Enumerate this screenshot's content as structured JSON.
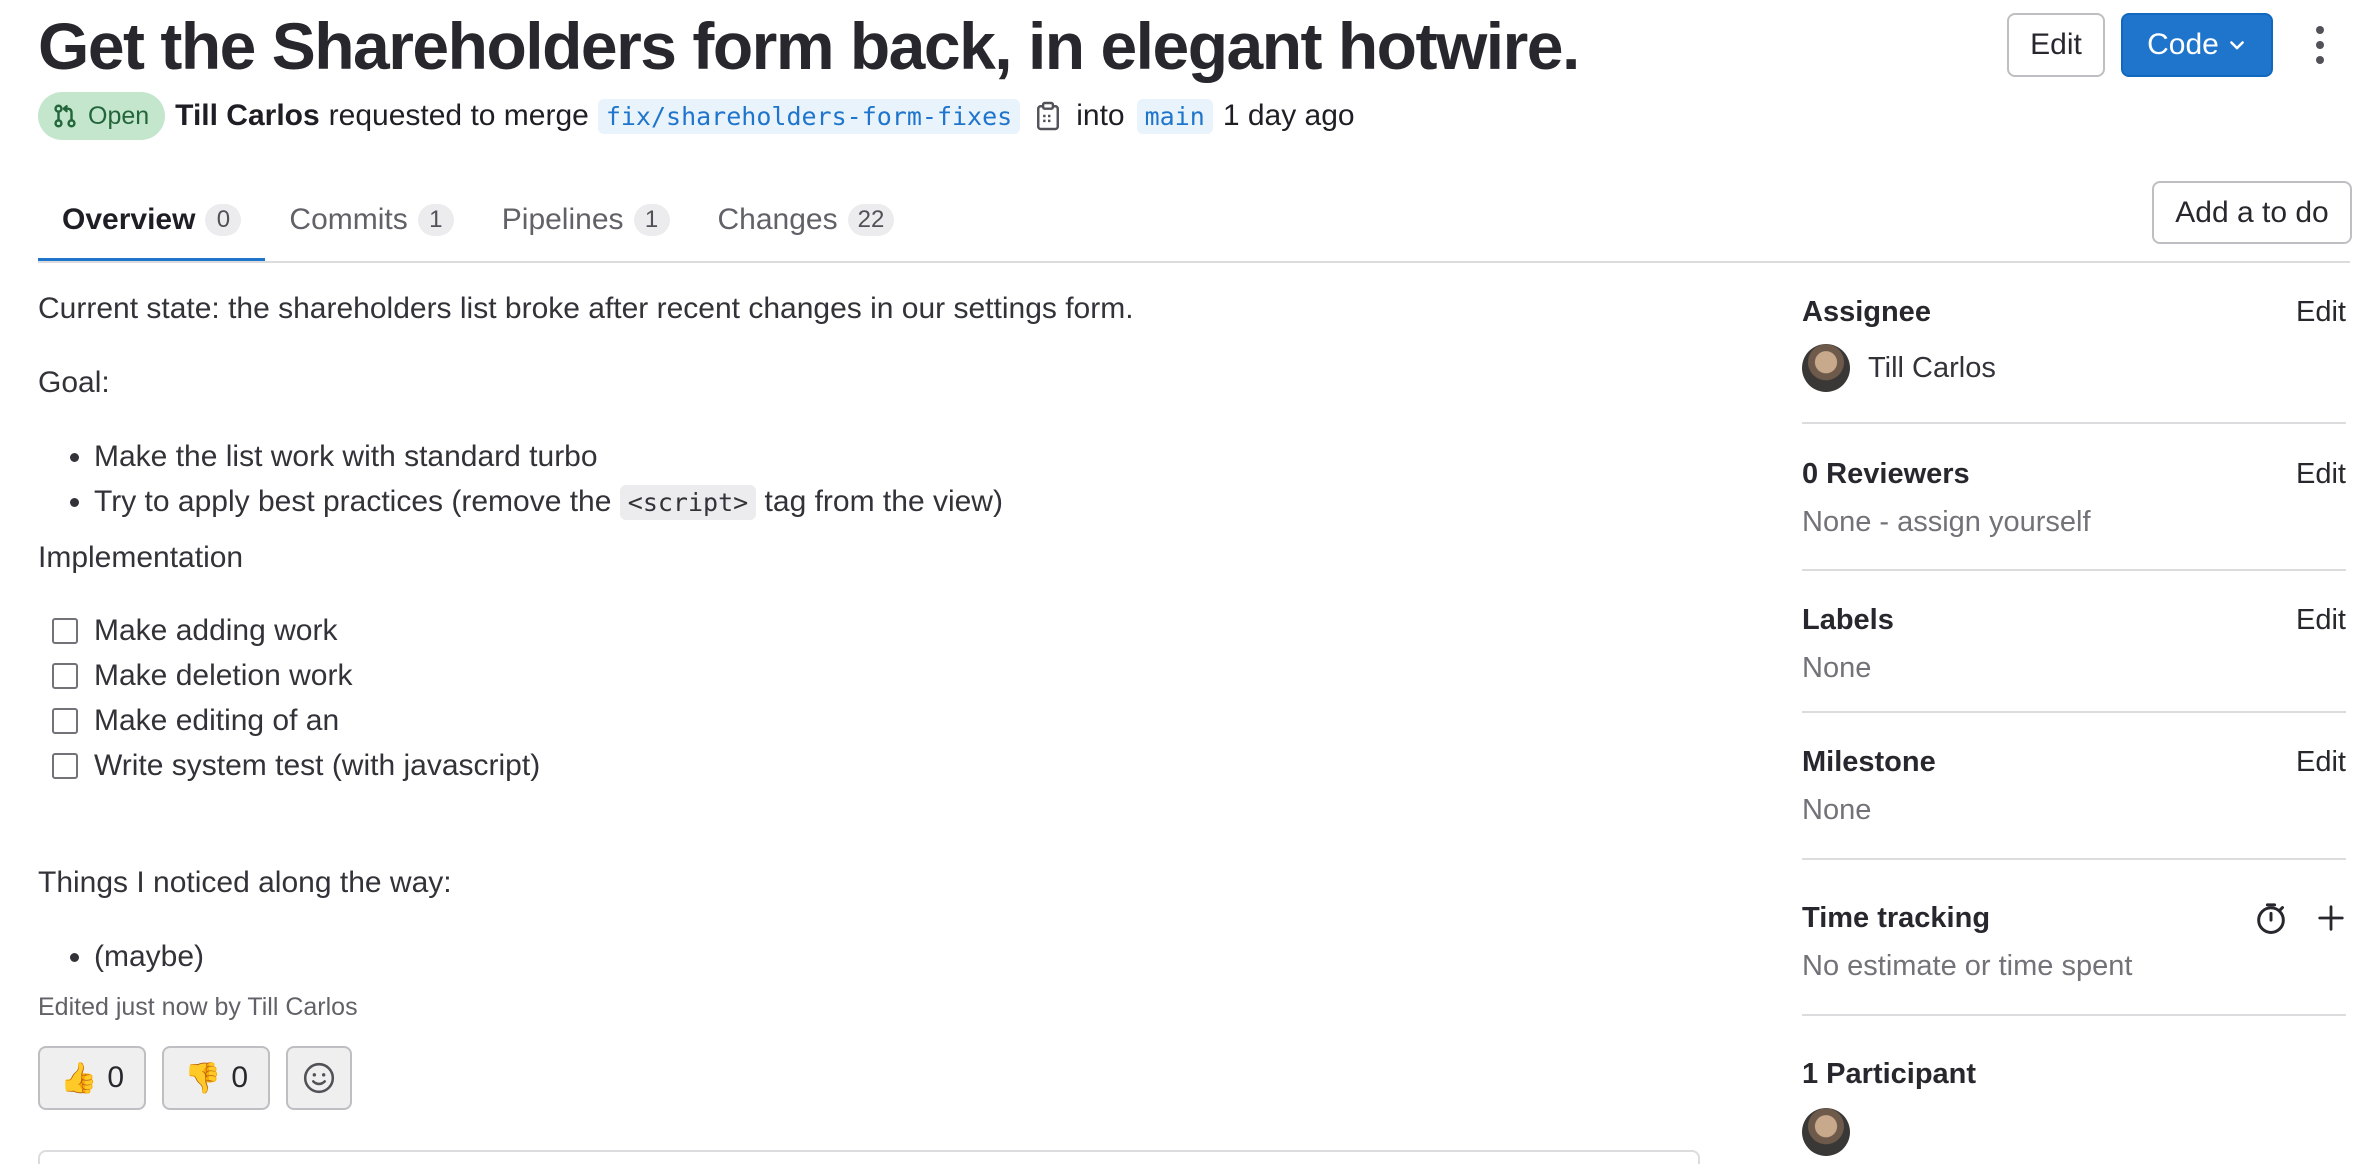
{
  "header": {
    "title": "Get the Shareholders form back, in elegant hotwire.",
    "status": "Open",
    "author": "Till Carlos",
    "action_text": "requested to merge",
    "source_branch": "fix/shareholders-form-fixes",
    "into_text": "into",
    "target_branch": "main",
    "time_ago": "1 day ago",
    "edit_label": "Edit",
    "code_label": "Code",
    "status_color": "#c3e6cd",
    "accent_color": "#1f75cb"
  },
  "tabs": [
    {
      "label": "Overview",
      "count": "0"
    },
    {
      "label": "Commits",
      "count": "1"
    },
    {
      "label": "Pipelines",
      "count": "1"
    },
    {
      "label": "Changes",
      "count": "22"
    }
  ],
  "todo_label": "Add a to do",
  "description": {
    "state": "Current state: the shareholders list broke after recent changes in our settings form.",
    "goal_heading": "Goal:",
    "goal_items": {
      "item1": "Make the list work with standard turbo",
      "item2_before": "Try to apply best practices (remove the",
      "item2_code": "<script>",
      "item2_after": "tag from the view)"
    },
    "implementation_heading": "Implementation",
    "tasks": [
      "Make adding work",
      "Make deletion work",
      "Make editing of an",
      "Write system test (with javascript)"
    ],
    "things_heading": "Things I noticed along the way:",
    "things_items": [
      "(maybe)"
    ],
    "edited_note": "Edited just now by Till Carlos"
  },
  "reactions": {
    "thumbs_up": "👍",
    "thumbs_up_count": "0",
    "thumbs_down": "👎",
    "thumbs_down_count": "0"
  },
  "sidebar": {
    "assignee": {
      "heading": "Assignee",
      "edit": "Edit",
      "name": "Till Carlos"
    },
    "reviewers": {
      "heading": "0 Reviewers",
      "edit": "Edit",
      "value": "None - assign yourself"
    },
    "labels": {
      "heading": "Labels",
      "edit": "Edit",
      "value": "None"
    },
    "milestone": {
      "heading": "Milestone",
      "edit": "Edit",
      "value": "None"
    },
    "time_tracking": {
      "heading": "Time tracking",
      "value": "No estimate or time spent"
    },
    "participants": {
      "heading": "1 Participant"
    }
  }
}
